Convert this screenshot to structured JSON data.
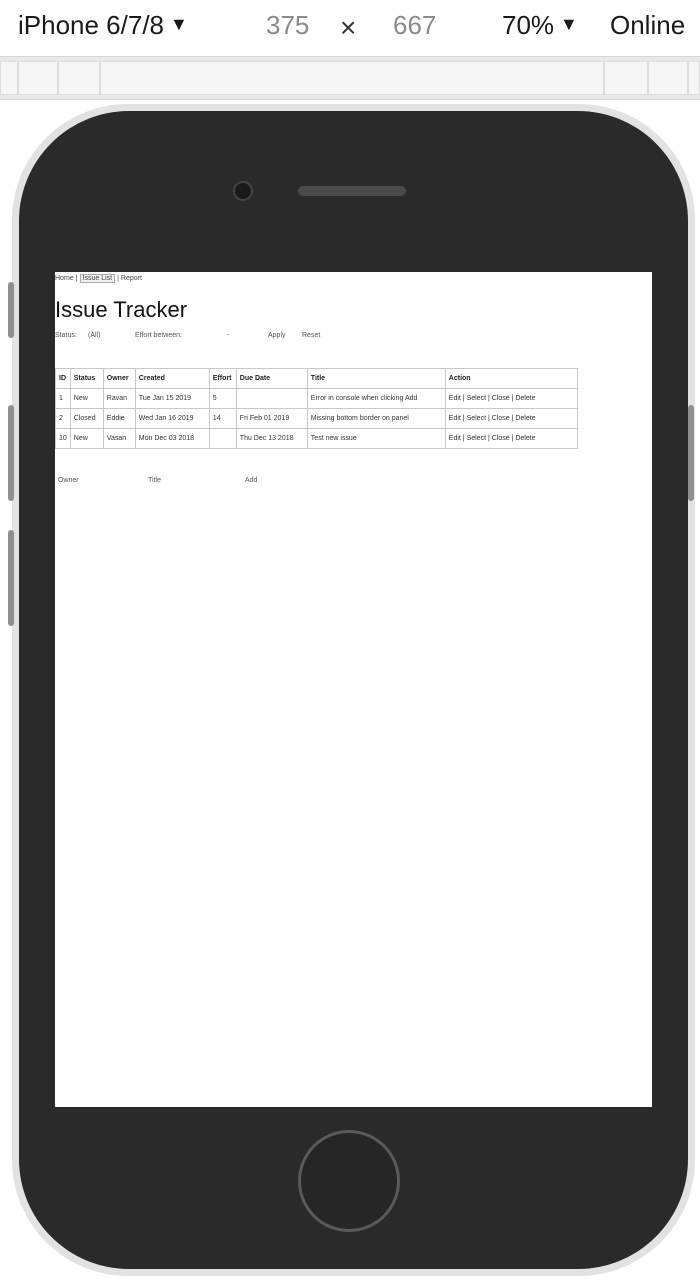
{
  "toolbar": {
    "device": "iPhone 6/7/8",
    "width": "375",
    "separator": "×",
    "height": "667",
    "zoom": "70%",
    "network": "Online"
  },
  "app": {
    "nav": {
      "home": "Home",
      "issue_list": "Issue List",
      "report": "Report"
    },
    "title": "Issue Tracker",
    "filter": {
      "status_label": "Status:",
      "status_value": "(All)",
      "effort_label": "Effort between:",
      "effort_dash": "-",
      "apply_label": "Apply",
      "reset_label": "Reset"
    },
    "table": {
      "headers": [
        "ID",
        "Status",
        "Owner",
        "Created",
        "Effort",
        "Due Date",
        "Title",
        "Action"
      ],
      "rows": [
        [
          "1",
          "New",
          "Ravan",
          "Tue Jan 15 2019",
          "5",
          "",
          "Error in console when clicking Add",
          "Edit | Select |  Close  |  Delete"
        ],
        [
          "2",
          "Closed",
          "Eddie",
          "Wed Jan 16 2019",
          "14",
          "Fri Feb 01 2019",
          "Missing bottom border on panel",
          "Edit | Select |  Close  |  Delete"
        ],
        [
          "10",
          "New",
          "Vasan",
          "Mon Dec 03 2018",
          "",
          "Thu Dec 13 2018",
          "Test new issue",
          "Edit | Select |  Close  |  Delete"
        ]
      ]
    },
    "add_form": {
      "owner_placeholder": "Owner",
      "title_placeholder": "Title",
      "add_label": "Add"
    }
  }
}
